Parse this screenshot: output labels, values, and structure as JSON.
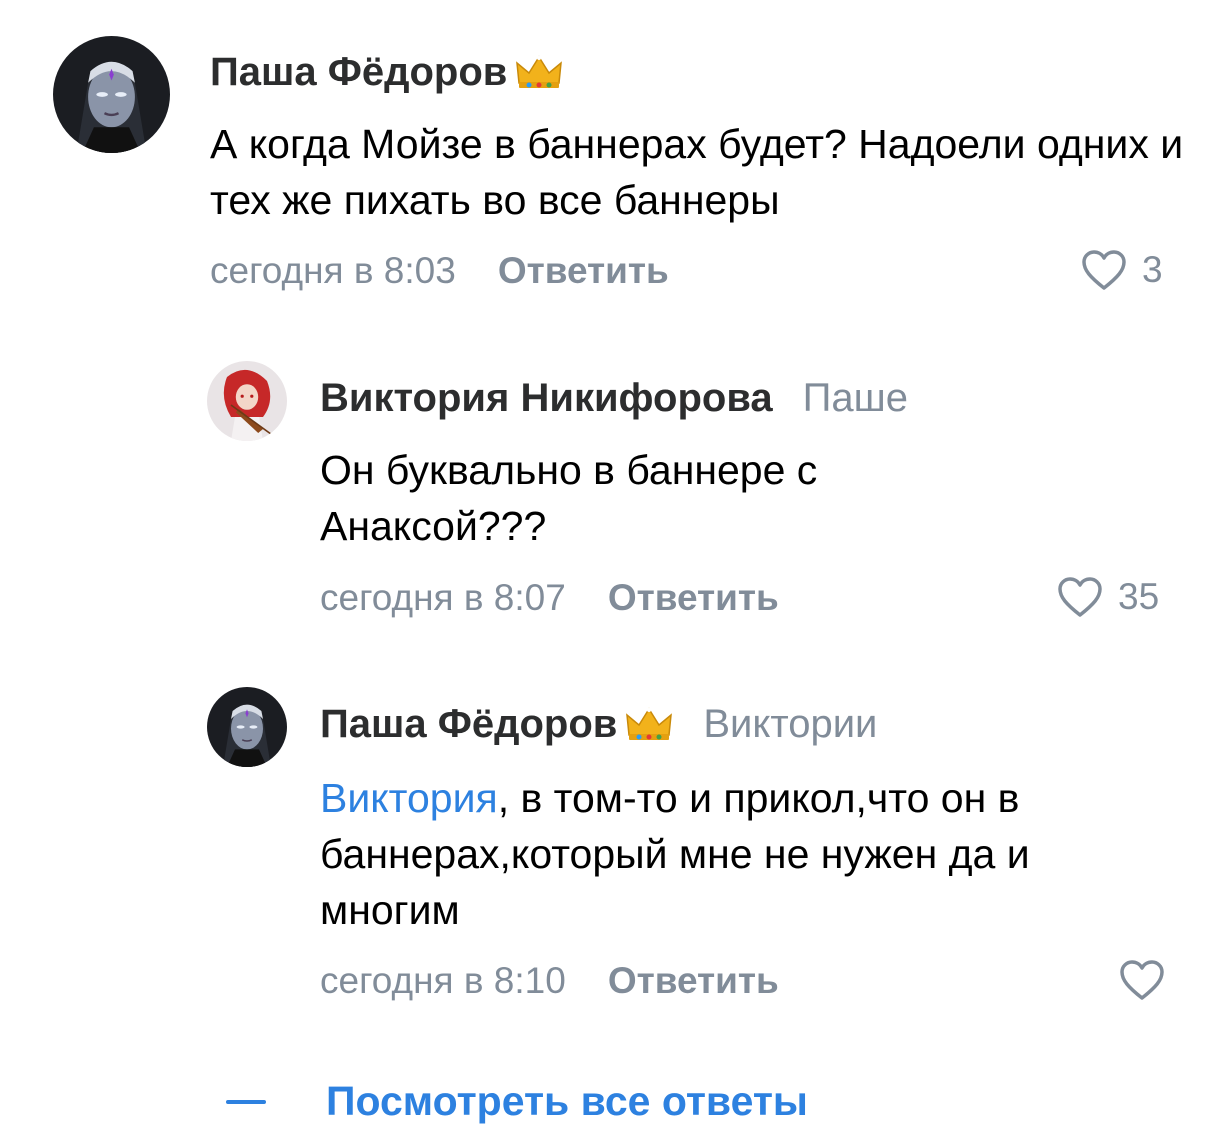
{
  "comments": [
    {
      "author": "Паша Фёдоров",
      "has_crown": true,
      "reply_to": "",
      "mention": "",
      "text": "А когда Мойзе в баннерах будет? Надоели одних и тех же пихать во все баннеры",
      "time": "сегодня в 8:03",
      "reply_label": "Ответить",
      "likes": "3",
      "avatar_icon": "dark-elf-avatar"
    },
    {
      "author": "Виктория Никифорова",
      "has_crown": false,
      "reply_to": "Паше",
      "mention": "",
      "text": "Он буквально в баннере с Анаксой???",
      "time": "сегодня в 8:07",
      "reply_label": "Ответить",
      "likes": "35",
      "avatar_icon": "red-hair-violinist-avatar"
    },
    {
      "author": "Паша Фёдоров",
      "has_crown": true,
      "reply_to": "Виктории",
      "mention": "Виктория",
      "text": ", в том-то и прикол,что он в баннерах,который мне не нужен да и многим",
      "time": "сегодня в 8:10",
      "reply_label": "Ответить",
      "likes": "",
      "avatar_icon": "dark-elf-avatar"
    }
  ],
  "show_all_replies": "Посмотреть все ответы",
  "colors": {
    "secondary": "#818c99",
    "accent": "#2d81e0",
    "author": "#2c2d2e"
  }
}
